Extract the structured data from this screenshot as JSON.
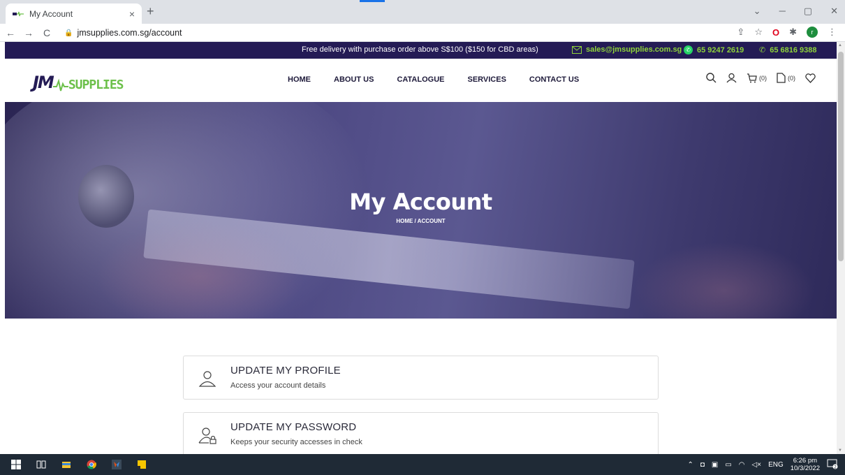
{
  "browser": {
    "tab_title": "My Account",
    "tab_close": "×",
    "new_tab": "+",
    "url": "jmsupplies.com.sg/account",
    "nav_back": "←",
    "nav_forward": "→",
    "nav_reload": "C"
  },
  "topbar": {
    "promo": "Free delivery with purchase order above S$100 ($150 for CBD areas)",
    "email": "sales@jmsupplies.com.sg",
    "whatsapp": "65 9247 2619",
    "phone": "65 6816 9388",
    "bg_color": "#241b55",
    "accent_color": "#8fd33a"
  },
  "logo": {
    "mark": "JM",
    "text": "SUPPLIES"
  },
  "nav": {
    "items": [
      "HOME",
      "ABOUT US",
      "CATALOGUE",
      "SERVICES",
      "CONTACT US"
    ]
  },
  "header_icons": {
    "cart_count": "(0)",
    "quote_count": "(0)"
  },
  "hero": {
    "title": "My Account",
    "breadcrumb": "HOME   /  ACCOUNT"
  },
  "cards": [
    {
      "title": "UPDATE MY PROFILE",
      "desc": "Access your account details",
      "icon": "user-icon"
    },
    {
      "title": "UPDATE MY PASSWORD",
      "desc": "Keeps your security accesses in check",
      "icon": "user-lock-icon"
    }
  ],
  "taskbar": {
    "lang": "ENG",
    "time": "6:26 pm",
    "date": "10/3/2022",
    "notif_count": "2"
  }
}
